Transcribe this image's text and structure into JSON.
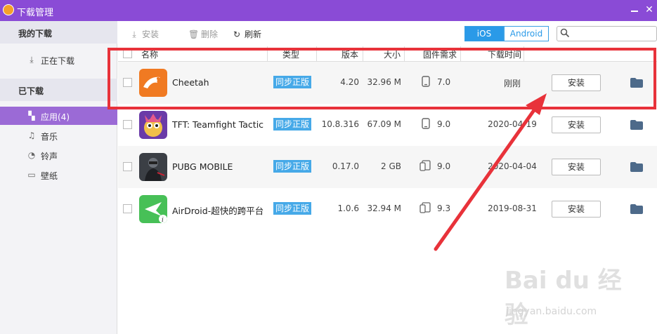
{
  "window": {
    "title": "下载管理"
  },
  "sidebar": {
    "my_downloads": "我的下载",
    "downloading": "正在下载",
    "downloaded": "已下载",
    "items": [
      {
        "label": "应用(4)",
        "icon": "apps-icon",
        "active": true
      },
      {
        "label": "音乐",
        "icon": "music-icon",
        "active": false
      },
      {
        "label": "铃声",
        "icon": "ringtone-icon",
        "active": false
      },
      {
        "label": "壁纸",
        "icon": "wallpaper-icon",
        "active": false
      }
    ]
  },
  "toolbar": {
    "install_label": "安装",
    "delete_label": "删除",
    "refresh_label": "刷新",
    "platform_ios": "iOS",
    "platform_android": "Android",
    "search_placeholder": ""
  },
  "table": {
    "headers": {
      "name": "名称",
      "type": "类型",
      "version": "版本",
      "size": "大小",
      "firmware": "固件需求",
      "time": "下载时间"
    },
    "rows": [
      {
        "name": "Cheetah",
        "type": "同步正版",
        "version": "4.20",
        "size": "32.96 M",
        "firmware": "7.0",
        "device": "phone",
        "time": "刚刚",
        "action": "安装"
      },
      {
        "name": "TFT: Teamfight Tactic",
        "type": "同步正版",
        "version": "10.8.316",
        "size": "67.09 M",
        "firmware": "9.0",
        "device": "phone",
        "time": "2020-04-19",
        "action": "安装"
      },
      {
        "name": "PUBG MOBILE",
        "type": "同步正版",
        "version": "0.17.0",
        "size": "2 GB",
        "firmware": "9.0",
        "device": "phone-tablet",
        "time": "2020-04-04",
        "action": "安装"
      },
      {
        "name": "AirDroid-超快的跨平台",
        "type": "同步正版",
        "version": "1.0.6",
        "size": "32.94 M",
        "firmware": "9.3",
        "device": "phone-tablet",
        "time": "2019-08-31",
        "action": "安装"
      }
    ]
  },
  "watermark": {
    "main": "Bai du 经验",
    "sub": "jingyan.baidu.com"
  },
  "colors": {
    "titlebar": "#8a4bd6",
    "active_item": "#9b6ad6",
    "badge": "#46a9e8",
    "highlight": "#e8323a"
  }
}
